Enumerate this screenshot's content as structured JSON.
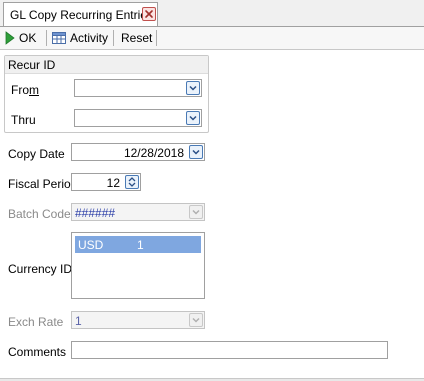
{
  "tab": {
    "title": "GL Copy Recurring Entries"
  },
  "toolbar": {
    "ok_label": "OK",
    "activity_label": "Activity",
    "reset_label": "Reset"
  },
  "recur_group": {
    "title": "Recur ID",
    "from_label_pre": "Fro",
    "from_label_mnemonic": "m",
    "thru_label": "Thru",
    "from_value": "",
    "thru_value": ""
  },
  "form": {
    "copy_date_label": "Copy Date",
    "copy_date_value": "12/28/2018",
    "fiscal_period_label": "Fiscal Period",
    "fiscal_period_value": "12",
    "batch_code_label": "Batch Code",
    "batch_code_value": "######",
    "currency_id_label": "Currency ID",
    "currency_items": [
      {
        "code": "USD",
        "value": "1"
      }
    ],
    "exch_rate_label": "Exch Rate",
    "exch_rate_value": "1",
    "comments_label": "Comments",
    "comments_value": ""
  },
  "colors": {
    "selection": "#7fa7e0",
    "ok_icon": "#2e9e3a",
    "close_icon": "#c0504d",
    "dropdown_accent": "#4a7ab5"
  },
  "icons": {
    "ok": "play-arrow-icon",
    "activity": "table-grid-icon",
    "close": "close-icon",
    "dropdown": "chevron-down-icon",
    "spinner": "spin-updown-icon"
  }
}
